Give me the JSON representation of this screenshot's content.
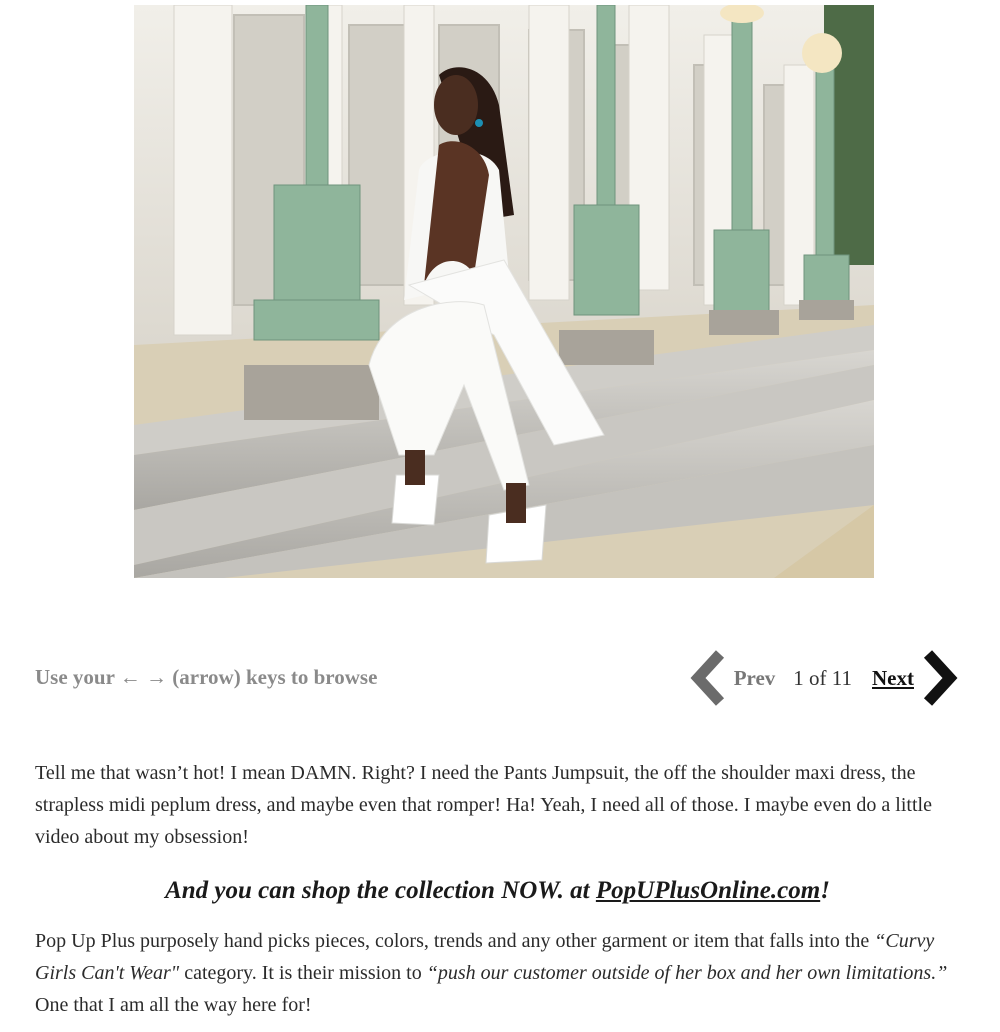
{
  "photo": {
    "alt_name": "fashion-photo"
  },
  "nav": {
    "browse_hint": "Use your ← → (arrow) keys to browse",
    "prev_label": "Prev",
    "page_count": "1 of 11",
    "next_label": "Next"
  },
  "article": {
    "paragraph1": "Tell me that wasn’t hot! I mean DAMN. Right? I need the Pants Jumpsuit, the off the shoulder maxi dress, the strapless midi peplum dress, and maybe even that romper! Ha! Yeah, I need all of those. I maybe even do a little video about my obsession!",
    "headline_prefix": "And you can shop the collection NOW. at ",
    "headline_link": "PopUPlusOnline.com",
    "headline_suffix": "!",
    "p2_part1": "Pop Up Plus purposely hand picks pieces, colors, trends and any other garment or item that falls into the ",
    "p2_quote1": "“Curvy Girls Can't Wear\"",
    "p2_part2": " category. It is their mission to ",
    "p2_quote2": "“push our customer outside of her box and her own limitations.”",
    "p2_part3": " One that I am all the way here for!"
  },
  "colors": {
    "prev_chevron": "#6b6b6b",
    "next_chevron": "#111111",
    "hint_text": "#8a8a8a"
  }
}
